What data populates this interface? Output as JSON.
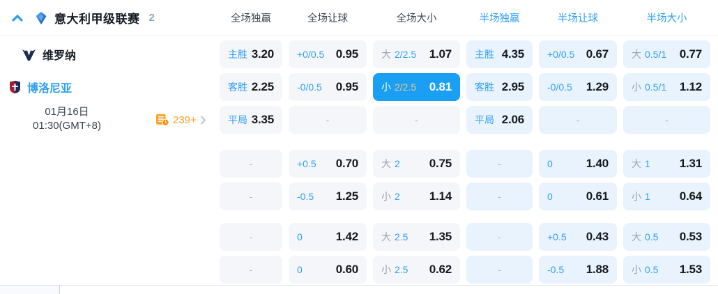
{
  "header": {
    "league_title": "意大利甲级联赛",
    "match_count": "2",
    "columns": [
      {
        "label": "全场独赢",
        "period": "full"
      },
      {
        "label": "全场让球",
        "period": "full"
      },
      {
        "label": "全场大小",
        "period": "full"
      },
      {
        "label": "半场独赢",
        "period": "half"
      },
      {
        "label": "半场让球",
        "period": "half"
      },
      {
        "label": "半场大小",
        "period": "half"
      }
    ]
  },
  "match": {
    "home_team": "维罗纳",
    "away_team": "博洛尼亚",
    "date": "01月16日",
    "time": "01:30(GMT+8)",
    "more_markets_count": "239+"
  },
  "icons": {
    "collapse": "chevron-up-icon",
    "league": "serie-a-logo",
    "home_crest": "verona-crest",
    "away_crest": "bologna-crest",
    "markets": "markets-history-icon",
    "more": "chevron-right-icon"
  },
  "colors": {
    "accent_blue": "#2f9ff4",
    "selected_bg": "#1a9ff4",
    "selected_handicap_gold": "#edc88c",
    "full_cell_bg": "#f4f6fa",
    "half_cell_bg": "#e9f3fd",
    "value_text": "#16191d",
    "prefix_gray": "#99a3ae",
    "markets_orange": "#ff9e27"
  },
  "odds": {
    "empty_placeholder": "-",
    "groups": [
      {
        "rows": [
          [
            {
              "label": "主胜",
              "value": "3.20",
              "state": "default"
            },
            {
              "label": "+0/0.5",
              "value": "0.95",
              "state": "default"
            },
            {
              "prefix": "大",
              "label": "2/2.5",
              "value": "1.07",
              "state": "default"
            },
            {
              "label": "主胜",
              "value": "4.35",
              "state": "default"
            },
            {
              "label": "+0/0.5",
              "value": "0.67",
              "state": "default"
            },
            {
              "prefix": "大",
              "label": "0.5/1",
              "value": "0.77",
              "state": "default"
            }
          ],
          [
            {
              "label": "客胜",
              "value": "2.25",
              "state": "default"
            },
            {
              "label": "-0/0.5",
              "value": "0.95",
              "state": "default"
            },
            {
              "prefix": "小",
              "label": "2/2.5",
              "value": "0.81",
              "state": "selected"
            },
            {
              "label": "客胜",
              "value": "2.95",
              "state": "default"
            },
            {
              "label": "-0/0.5",
              "value": "1.29",
              "state": "default"
            },
            {
              "prefix": "小",
              "label": "0.5/1",
              "value": "1.12",
              "state": "default"
            }
          ],
          [
            {
              "label": "平局",
              "value": "3.35",
              "state": "default"
            },
            {
              "state": "empty"
            },
            {
              "state": "empty"
            },
            {
              "label": "平局",
              "value": "2.06",
              "state": "default"
            },
            {
              "state": "empty"
            },
            {
              "state": "empty"
            }
          ]
        ]
      },
      {
        "rows": [
          [
            {
              "state": "empty"
            },
            {
              "label": "+0.5",
              "value": "0.70",
              "state": "default"
            },
            {
              "prefix": "大",
              "label": "2",
              "value": "0.75",
              "state": "default"
            },
            {
              "state": "empty"
            },
            {
              "label": "0",
              "value": "1.40",
              "state": "default"
            },
            {
              "prefix": "大",
              "label": "1",
              "value": "1.31",
              "state": "default"
            }
          ],
          [
            {
              "state": "empty"
            },
            {
              "label": "-0.5",
              "value": "1.25",
              "state": "default"
            },
            {
              "prefix": "小",
              "label": "2",
              "value": "1.14",
              "state": "default"
            },
            {
              "state": "empty"
            },
            {
              "label": "0",
              "value": "0.61",
              "state": "default"
            },
            {
              "prefix": "小",
              "label": "1",
              "value": "0.64",
              "state": "default"
            }
          ]
        ]
      },
      {
        "rows": [
          [
            {
              "state": "empty"
            },
            {
              "label": "0",
              "value": "1.42",
              "state": "default"
            },
            {
              "prefix": "大",
              "label": "2.5",
              "value": "1.35",
              "state": "default"
            },
            {
              "state": "empty"
            },
            {
              "label": "+0.5",
              "value": "0.43",
              "state": "default"
            },
            {
              "prefix": "大",
              "label": "0.5",
              "value": "0.53",
              "state": "default"
            }
          ],
          [
            {
              "state": "empty"
            },
            {
              "label": "0",
              "value": "0.60",
              "state": "default"
            },
            {
              "prefix": "小",
              "label": "2.5",
              "value": "0.62",
              "state": "default"
            },
            {
              "state": "empty"
            },
            {
              "label": "-0.5",
              "value": "1.88",
              "state": "default"
            },
            {
              "prefix": "小",
              "label": "0.5",
              "value": "1.53",
              "state": "default"
            }
          ]
        ]
      }
    ]
  }
}
